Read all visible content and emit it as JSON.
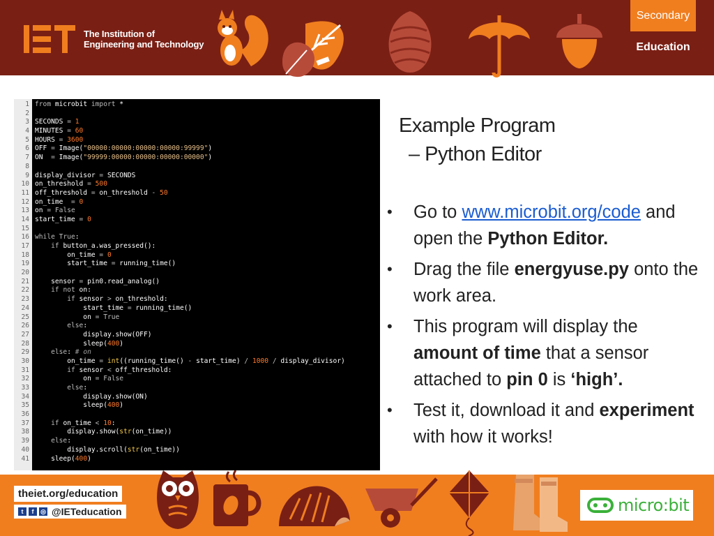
{
  "header": {
    "org_line1": "The Institution of",
    "org_line2": "Engineering and Technology",
    "badge_top": "Secondary",
    "badge_bottom": "Education"
  },
  "title": {
    "line1": "Example Program",
    "line2": "– Python Editor"
  },
  "bullets": [
    {
      "t1": "Go to ",
      "link": "www.microbit.org/code",
      "t2": " and open the ",
      "b1": "Python Editor."
    },
    {
      "t1": "Drag the file ",
      "b1": "energyuse.py",
      "t2": " onto the work area."
    },
    {
      "t1": "This program will display the ",
      "b1": "amount of time",
      "t2": " that a sensor attached to ",
      "b2": "pin 0",
      "t3": " is ",
      "b3": "‘high’."
    },
    {
      "t1": "Test it, download it and ",
      "b1": "experiment",
      "t2": " with how it works!"
    }
  ],
  "code_lines": [
    "from microbit import *",
    "",
    "SECONDS = 1",
    "MINUTES = 60",
    "HOURS = 3600",
    "OFF = Image(\"00000:00000:00000:00000:99999\")",
    "ON  = Image(\"99999:00000:00000:00000:00000\")",
    "",
    "display_divisor = SECONDS",
    "on_threshold = 500",
    "off_threshold = on_threshold - 50",
    "on_time  = 0",
    "on = False",
    "start_time = 0",
    "",
    "while True:",
    "    if button_a.was_pressed():",
    "        on_time = 0",
    "        start_time = running_time()",
    "",
    "    sensor = pin0.read_analog()",
    "    if not on:",
    "        if sensor > on_threshold:",
    "            start_time = running_time()",
    "            on = True",
    "        else:",
    "            display.show(OFF)",
    "            sleep(400)",
    "    else: # on",
    "        on_time = int((running_time() - start_time) / 1000 / display_divisor)",
    "        if sensor < off_threshold:",
    "            on = False",
    "        else:",
    "            display.show(ON)",
    "            sleep(400)",
    "",
    "    if on_time < 10:",
    "        display.show(str(on_time))",
    "    else:",
    "        display.scroll(str(on_time))",
    "    sleep(400)"
  ],
  "footer": {
    "url": "theiet.org/education",
    "handle": "@IETeducation",
    "microbit": "micro:bit"
  },
  "colors": {
    "header_bg": "#7a1f14",
    "accent_orange": "#f07e1f",
    "microbit_green": "#3bb03a"
  }
}
